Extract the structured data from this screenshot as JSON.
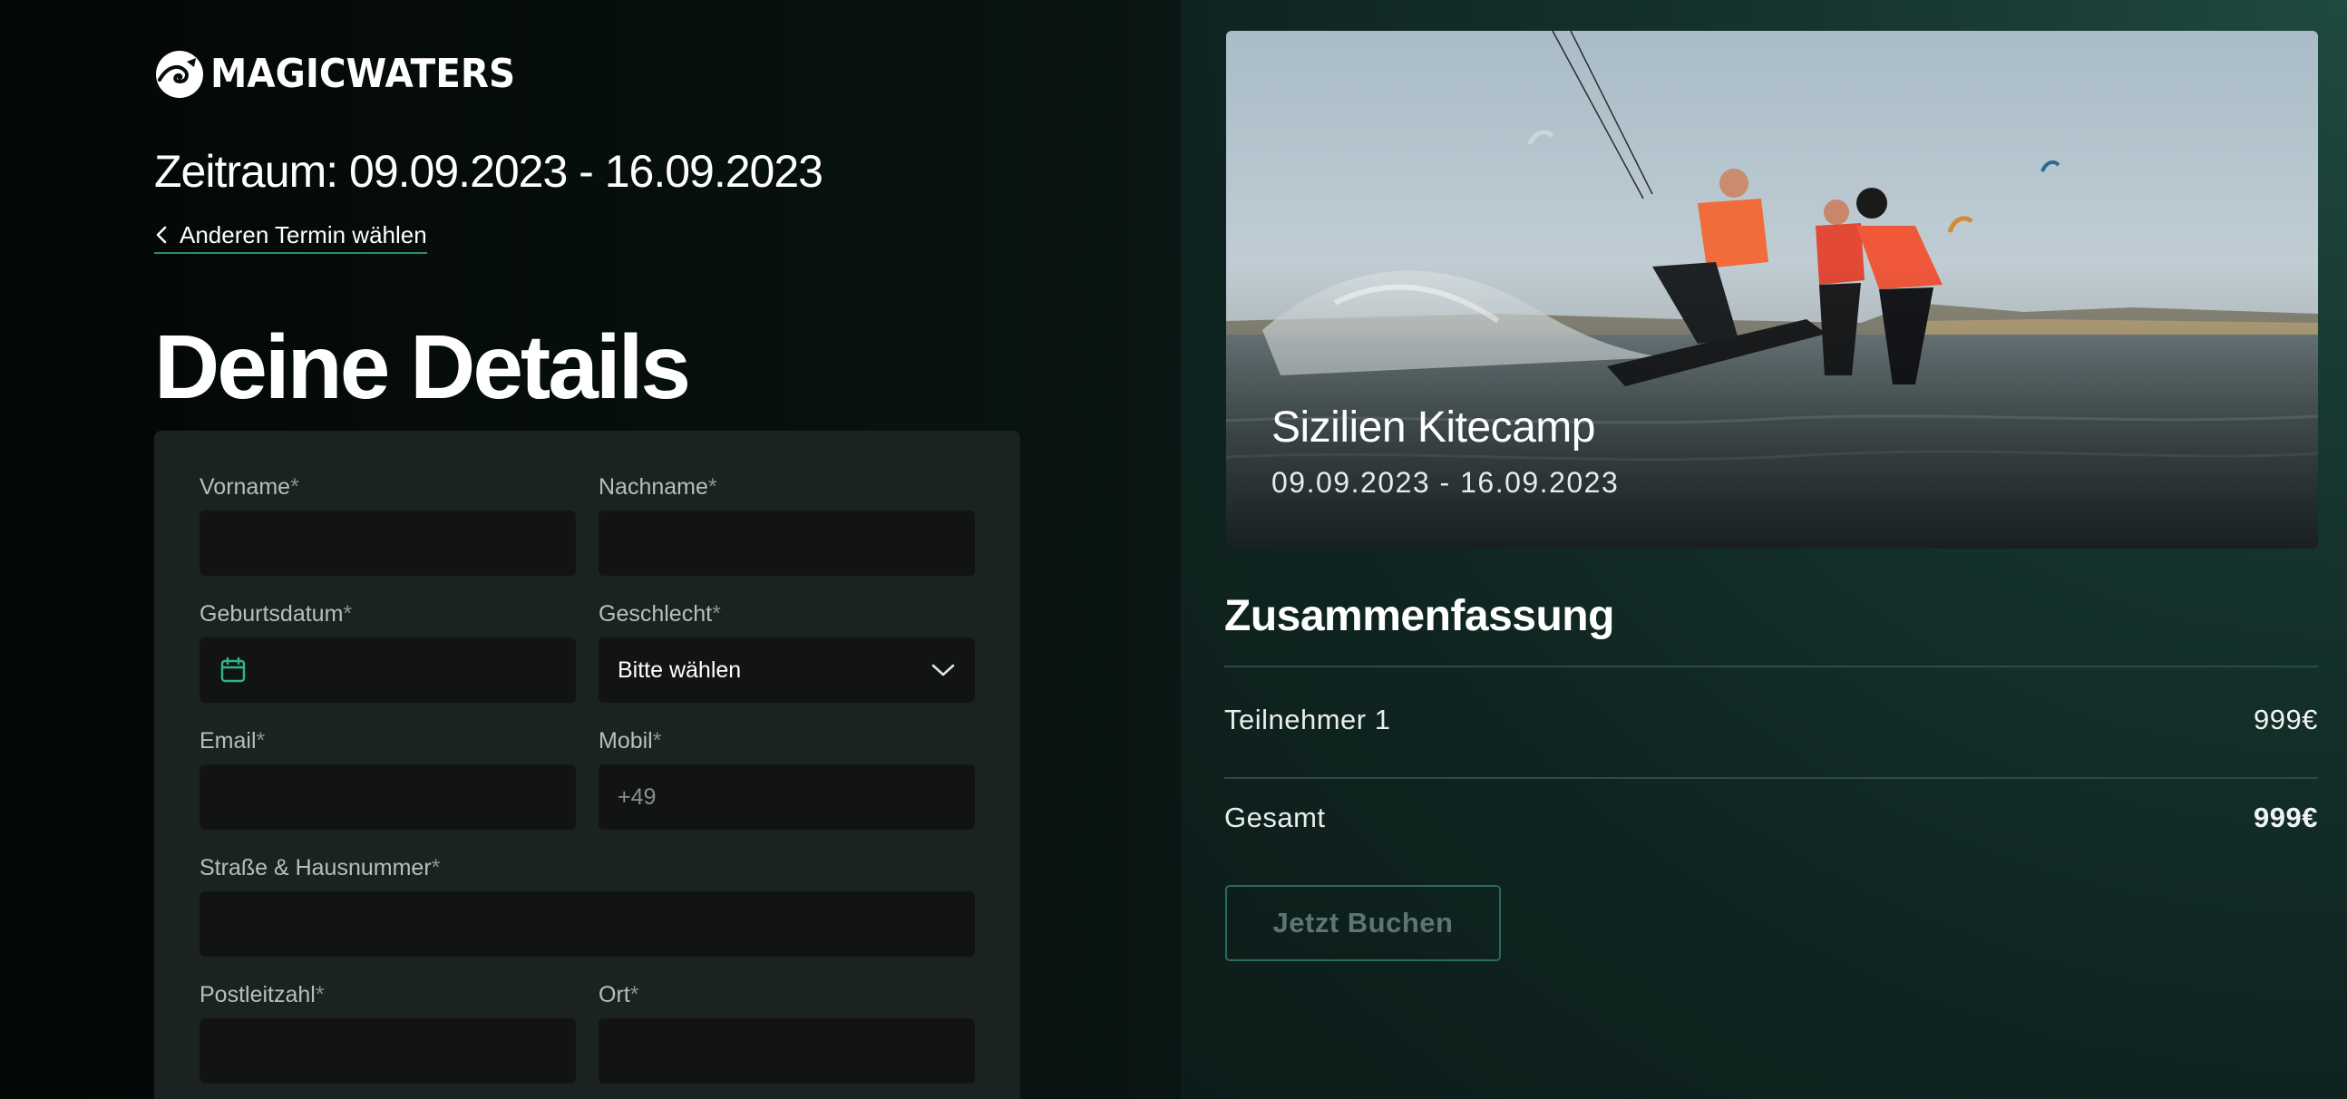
{
  "brand": {
    "name": "MAGICWATERS",
    "logo_icon": "wave-logo-icon"
  },
  "header": {
    "period": "Zeitraum: 09.09.2023 - 16.09.2023",
    "back_link": "Anderen Termin wählen"
  },
  "form": {
    "title": "Deine Details",
    "fields": {
      "first_name": {
        "label": "Vorname",
        "required_mark": "*",
        "value": ""
      },
      "last_name": {
        "label": "Nachname",
        "required_mark": "*",
        "value": ""
      },
      "birthdate": {
        "label": "Geburtsdatum",
        "required_mark": "*",
        "value": "",
        "icon": "calendar-icon"
      },
      "gender": {
        "label": "Geschlecht",
        "required_mark": "*",
        "selected": "Bitte wählen",
        "icon": "chevron-down-icon"
      },
      "email": {
        "label": "Email",
        "required_mark": "*",
        "value": ""
      },
      "mobile": {
        "label": "Mobil",
        "required_mark": "*",
        "placeholder": "+49"
      },
      "street": {
        "label": "Straße & Hausnummer",
        "required_mark": "*",
        "value": ""
      },
      "zip": {
        "label": "Postleitzahl",
        "required_mark": "*",
        "value": ""
      },
      "city": {
        "label": "Ort",
        "required_mark": "*",
        "value": ""
      }
    }
  },
  "camp": {
    "title": "Sizilien Kitecamp",
    "dates": "09.09.2023 - 16.09.2023"
  },
  "summary": {
    "title": "Zusammenfassung",
    "rows": [
      {
        "label": "Teilnehmer 1",
        "value": "999€"
      },
      {
        "label": "Gesamt",
        "value": "999€"
      }
    ],
    "book_button": "Jetzt Buchen"
  },
  "colors": {
    "accent": "#2e8c6e",
    "field_bg": "#121414",
    "card_bg": "#1b2322"
  }
}
